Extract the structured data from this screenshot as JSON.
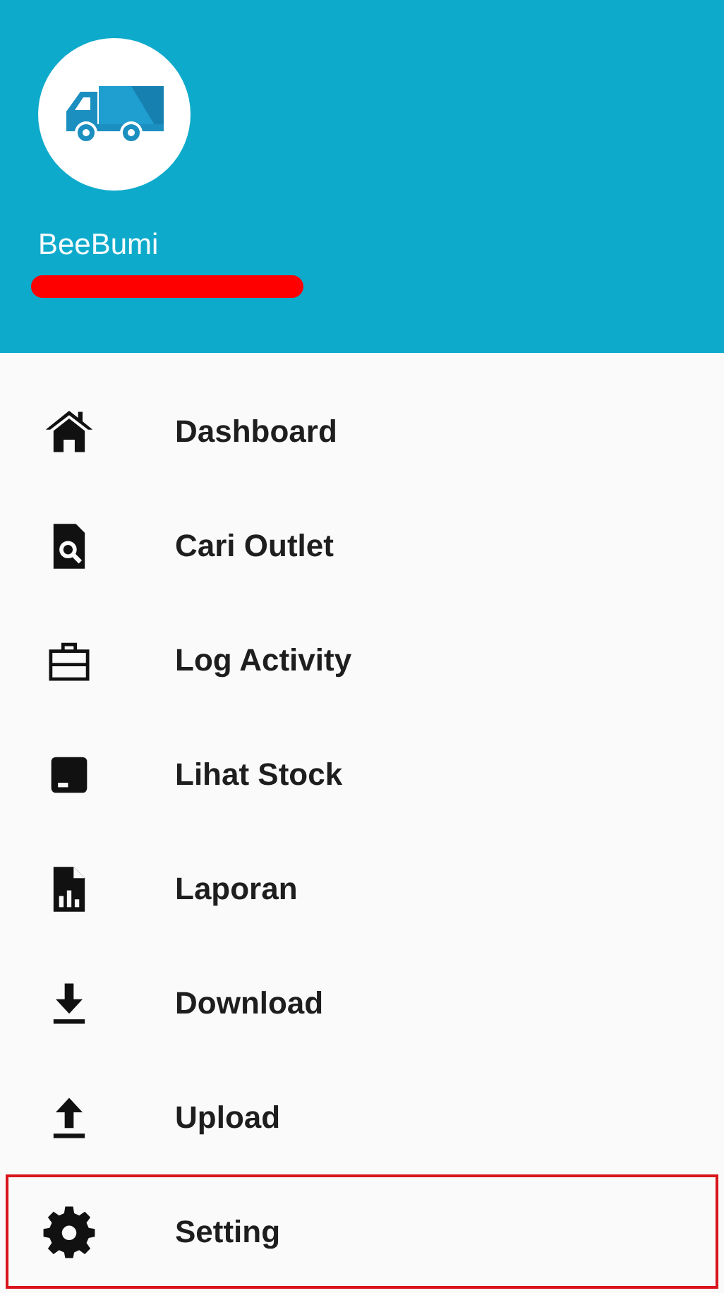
{
  "header": {
    "name": "BeeBumi",
    "email_redacted": true
  },
  "menu": [
    {
      "label": "Dashboard",
      "kind": "home",
      "highlighted": false
    },
    {
      "label": "Cari Outlet",
      "kind": "search-file",
      "highlighted": false
    },
    {
      "label": "Log Activity",
      "kind": "briefcase",
      "highlighted": false
    },
    {
      "label": "Lihat Stock",
      "kind": "box",
      "highlighted": false
    },
    {
      "label": "Laporan",
      "kind": "report",
      "highlighted": false
    },
    {
      "label": "Download",
      "kind": "download",
      "highlighted": false
    },
    {
      "label": "Upload",
      "kind": "upload",
      "highlighted": false
    },
    {
      "label": "Setting",
      "kind": "gear",
      "highlighted": true
    }
  ]
}
